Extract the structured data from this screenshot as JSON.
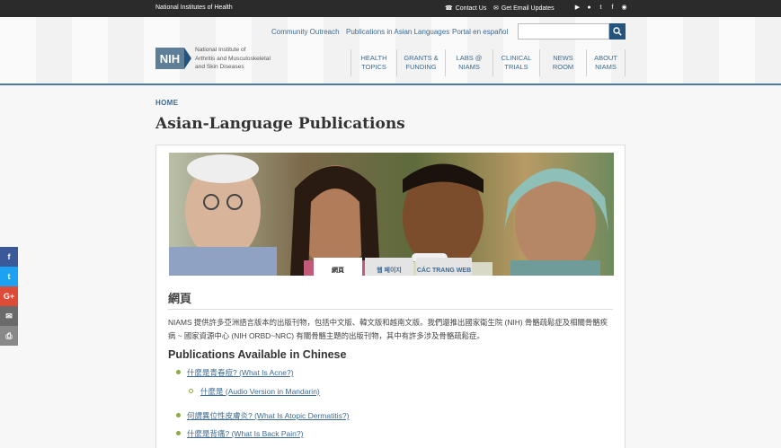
{
  "topbar": {
    "org": "National Institutes of Health",
    "contact": "Contact Us",
    "email": "Get Email Updates"
  },
  "utility": {
    "community": "Community Outreach",
    "asian": "Publications in Asian Languages",
    "spanish": "Portal en español"
  },
  "search": {
    "placeholder": ""
  },
  "logo": {
    "mark": "NIH",
    "line1": "National Institute of",
    "line2": "Arthritis and Musculoskeletal",
    "line3": "and Skin Diseases"
  },
  "nav": [
    {
      "l1": "HEALTH",
      "l2": "TOPICS"
    },
    {
      "l1": "GRANTS &",
      "l2": "FUNDING"
    },
    {
      "l1": "LABS @",
      "l2": "NIAMS"
    },
    {
      "l1": "CLINICAL",
      "l2": "TRIALS"
    },
    {
      "l1": "NEWS",
      "l2": "ROOM"
    },
    {
      "l1": "ABOUT",
      "l2": "NIAMS"
    }
  ],
  "breadcrumb": "HOME",
  "title": "Asian-Language Publications",
  "tabs": [
    "網頁",
    "웹 페이지",
    "CÁC TRANG WEB"
  ],
  "section_head": "網頁",
  "paragraph": "NIAMS 提供許多亞洲語言版本的出版刊物，包括中文版、韓文版和越南文版。我們還推出國家衛生院 (NIH) 骨骼疏鬆症及相關骨骼疾病 ~ 國家資源中心 (NIH ORBD~NRC) 有關骨骼主題的出版刊物，其中有許多涉及骨骼疏鬆症。",
  "pub_head": "Publications Available in Chinese",
  "links": {
    "acne": "什麼是青春痘? (What Is Acne?)",
    "audio": "什麼是 (Audio Version in Mandarin)",
    "atopic": "何謂異位性皮膚炎? (What Is Atopic Dermatitis?)",
    "back": "什麼是背痛? (What Is Back Pain?)"
  },
  "colors": {
    "accent": "#24537b",
    "link": "#3d6b93",
    "bullet": "#8ea845"
  }
}
